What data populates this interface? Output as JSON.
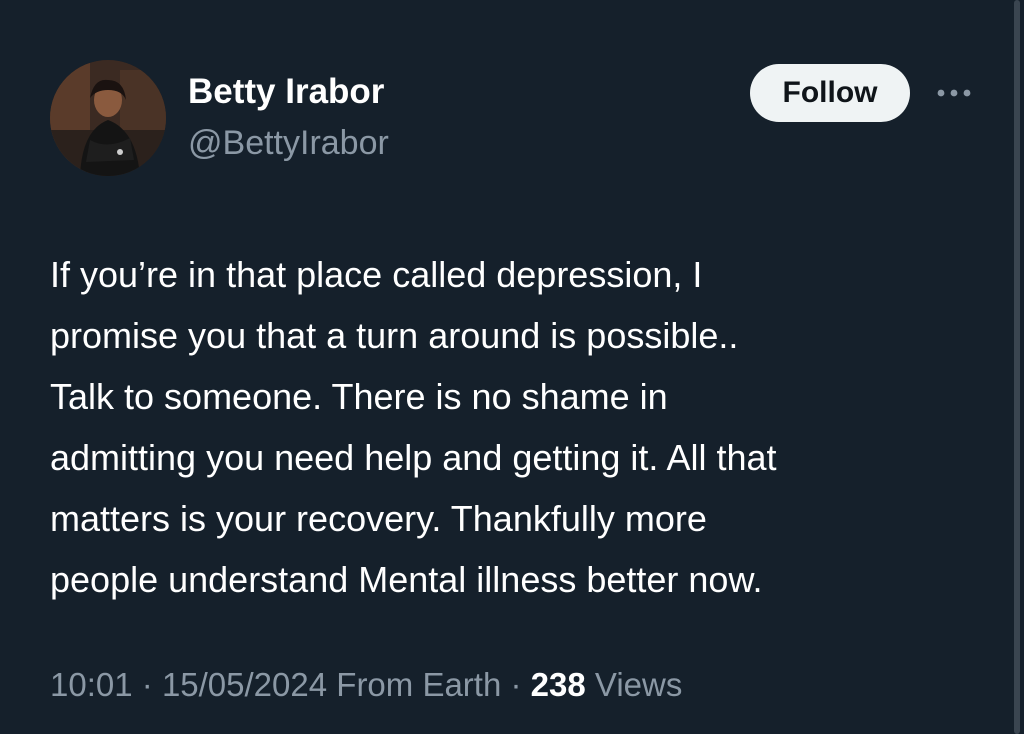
{
  "tweet": {
    "author": {
      "name": "Betty Irabor",
      "handle": "@BettyIrabor"
    },
    "follow_label": "Follow",
    "more_icon": "more-horizontal-icon",
    "text_lines": [
      "If you’re in that place called depression, I",
      "promise you that a turn around is possible..",
      "Talk to someone. There is no shame in",
      "admitting you need help and getting it. All that",
      "matters is your recovery. Thankfully more",
      "people understand Mental illness better now."
    ],
    "time": "10:01",
    "date": "15/05/2024",
    "source": "From Earth",
    "separator": "·",
    "views_count": "238",
    "views_label": "Views"
  },
  "colors": {
    "background": "#15202b",
    "text": "#ffffff",
    "secondary_text": "#8b98a5",
    "follow_bg": "#eff3f4",
    "follow_text": "#0f1419"
  }
}
